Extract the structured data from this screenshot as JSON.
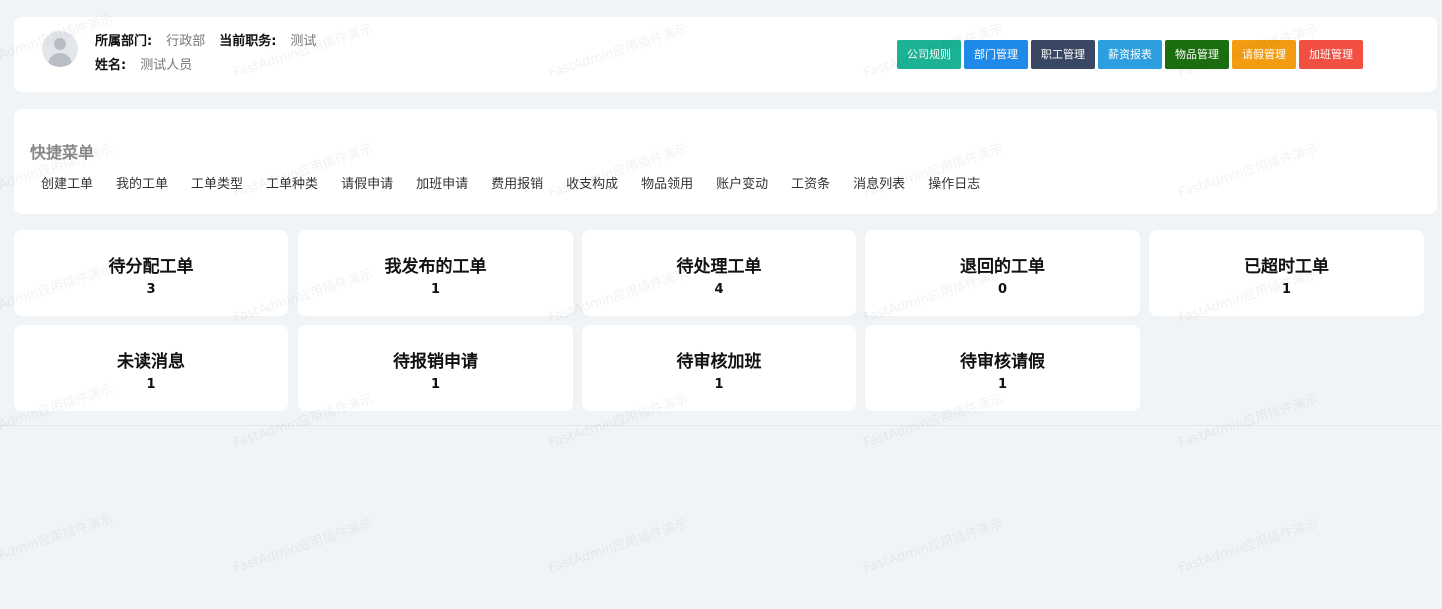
{
  "header": {
    "dept_label": "所属部门:",
    "dept_value": "行政部",
    "position_label": "当前职务:",
    "position_value": "测试",
    "name_label": "姓名:",
    "name_value": "测试人员",
    "buttons": [
      {
        "label": "公司规则",
        "color": "#1bb394"
      },
      {
        "label": "部门管理",
        "color": "#1f8ae8"
      },
      {
        "label": "职工管理",
        "color": "#3a4762"
      },
      {
        "label": "薪资报表",
        "color": "#2d9fe0"
      },
      {
        "label": "物品管理",
        "color": "#1b6e10"
      },
      {
        "label": "请假管理",
        "color": "#f39c12"
      },
      {
        "label": "加班管理",
        "color": "#f04f41"
      }
    ]
  },
  "quick_menu": {
    "title": "快捷菜单",
    "links": [
      "创建工单",
      "我的工单",
      "工单类型",
      "工单种类",
      "请假申请",
      "加班申请",
      "费用报销",
      "收支构成",
      "物品领用",
      "账户变动",
      "工资条",
      "消息列表",
      "操作日志"
    ]
  },
  "stats": [
    {
      "title": "待分配工单",
      "count": "3"
    },
    {
      "title": "我发布的工单",
      "count": "1"
    },
    {
      "title": "待处理工单",
      "count": "4"
    },
    {
      "title": "退回的工单",
      "count": "0"
    },
    {
      "title": "已超时工单",
      "count": "1"
    },
    {
      "title": "未读消息",
      "count": "1"
    },
    {
      "title": "待报销申请",
      "count": "1"
    },
    {
      "title": "待审核加班",
      "count": "1"
    },
    {
      "title": "待审核请假",
      "count": "1"
    }
  ],
  "watermark": "FastAdmin应用插件演示"
}
